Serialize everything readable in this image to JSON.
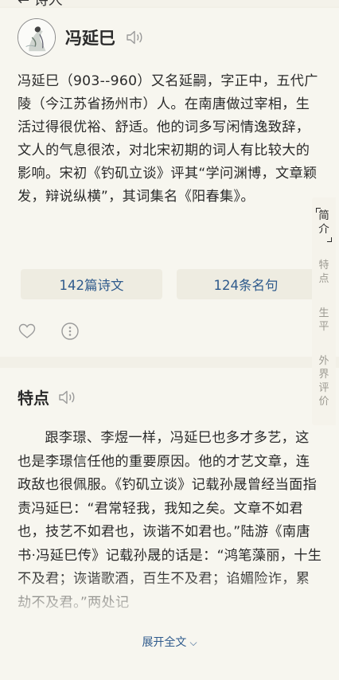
{
  "header": {
    "partial_title": "← 诗人"
  },
  "author": {
    "name": "冯延巳",
    "bio": "冯延巳（903--960）又名延嗣，字正中，五代广陵（今江苏省扬州市）人。在南唐做过宰相，生活过得很优裕、舒适。他的词多写闲情逸致辞，文人的气息很浓，对北宋初期的词人有比较大的影响。宋初《钓矶立谈》评其“学问渊博，文章颖发，辩说纵横”，其词集名《阳春集》。",
    "stats": {
      "poems": "142篇诗文",
      "quotes": "124条名句"
    }
  },
  "features": {
    "title": "特点",
    "text": "跟李璟、李煜一样，冯延巳也多才多艺，这也是李璟信任他的重要原因。他的才艺文章，连政敌也很佩服。《钓矶立谈》记载孙晟曾经当面指责冯延巳：“君常轻我，我知之矣。文章不如君也，技艺不如君也，诙谐不如君也。”陆游《南唐书·冯延巳传》记载孙晟的话是：“鸿笔藻丽，十生不及君；诙谐歌酒，百生不及君；谄媚险诈，累劫不及君。”两处记",
    "expand_label": "展开全文"
  },
  "side_nav": [
    {
      "label": "简介",
      "active": true
    },
    {
      "label": "特点",
      "active": false
    },
    {
      "label": "生平",
      "active": false
    },
    {
      "label": "外界评价",
      "active": false
    }
  ],
  "colors": {
    "link": "#2e5a8c",
    "background": "#f2f0e7",
    "card": "#f7f6ef"
  },
  "icons": {
    "speaker": "speaker-icon",
    "like": "heart-icon",
    "more": "more-icon",
    "expand": "chevron-down-icon"
  }
}
